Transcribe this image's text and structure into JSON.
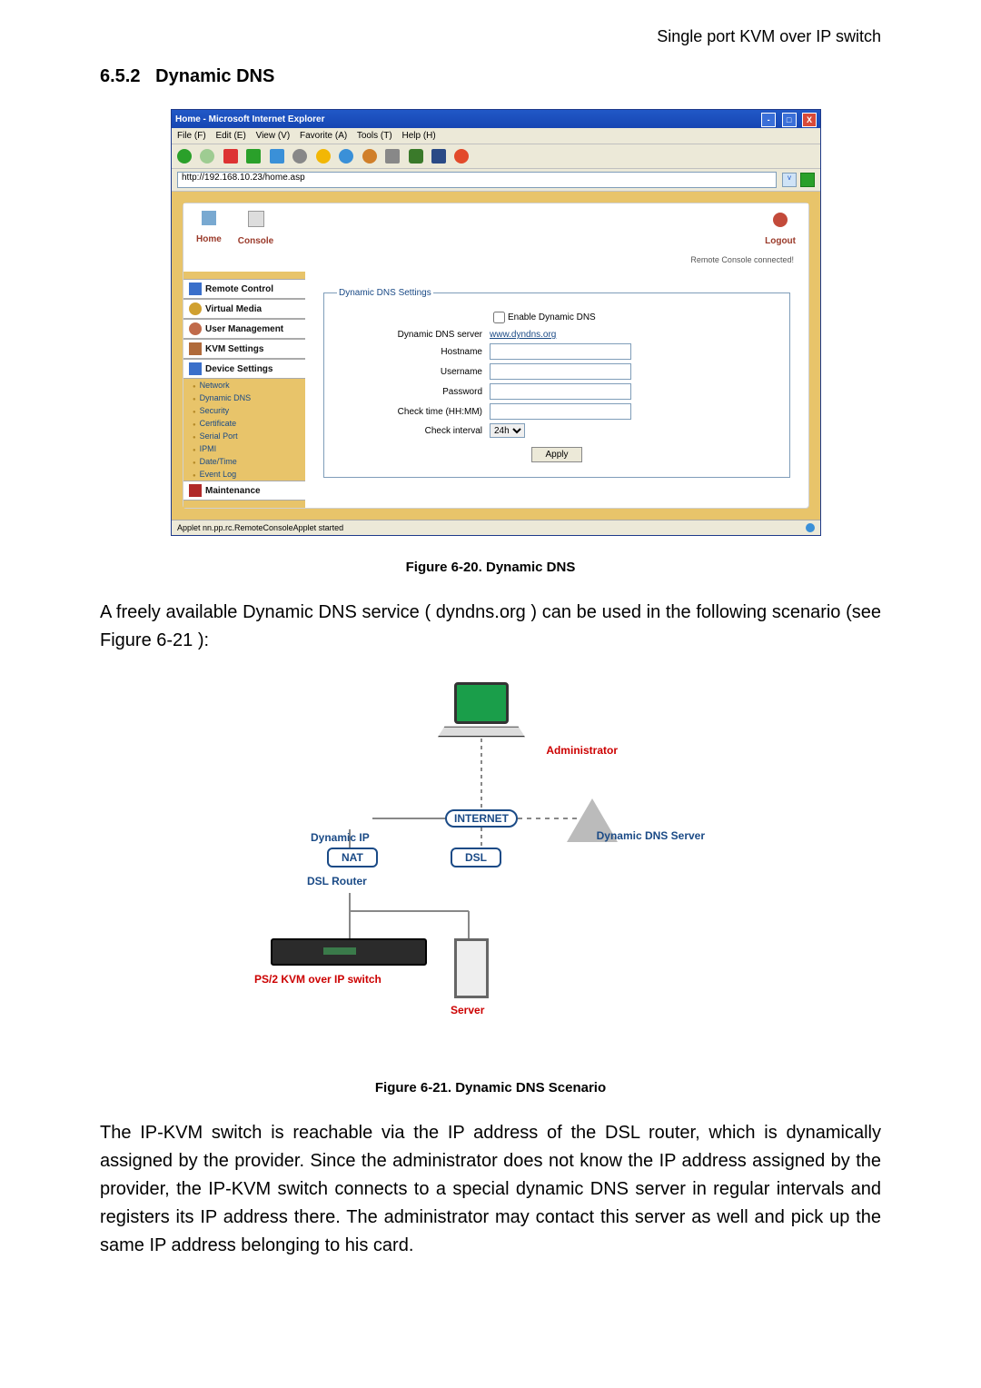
{
  "header": "Single port KVM over IP switch",
  "section": {
    "number": "6.5.2",
    "title": "Dynamic DNS"
  },
  "iewin": {
    "title": "Home - Microsoft Internet Explorer",
    "menubar": [
      "File (F)",
      "Edit (E)",
      "View (V)",
      "Favorite (A)",
      "Tools (T)",
      "Help (H)"
    ],
    "address": "http://192.168.10.23/home.asp",
    "nav_top": {
      "home": "Home",
      "console": "Console",
      "logout": "Logout"
    },
    "status_right": "Remote Console connected!",
    "nav": {
      "remote_control": "Remote Control",
      "virtual_media": "Virtual Media",
      "user_management": "User Management",
      "kvm_settings": "KVM Settings",
      "device_settings": "Device Settings",
      "subitems": {
        "network": "Network",
        "dynamic_dns": "Dynamic DNS",
        "security": "Security",
        "certificate": "Certificate",
        "serial_port": "Serial Port",
        "ipmi": "IPMI",
        "date_time": "Date/Time",
        "event_log": "Event Log"
      },
      "maintenance": "Maintenance"
    },
    "form": {
      "legend": "Dynamic DNS Settings",
      "enable": "Enable Dynamic DNS",
      "server_label": "Dynamic DNS server",
      "server_value": "www.dyndns.org",
      "hostname": "Hostname",
      "username": "Username",
      "password": "Password",
      "check_time": "Check time (HH:MM)",
      "check_interval": "Check interval",
      "interval_value": "24h",
      "apply": "Apply"
    },
    "statusbar": "Applet nn.pp.rc.RemoteConsoleApplet started"
  },
  "caption1": "Figure 6-20. Dynamic DNS",
  "para1": "A freely available Dynamic DNS service ( dyndns.org ) can be used in the following scenario (see Figure 6-21 ):",
  "diagram": {
    "admin": "Administrator",
    "internet": "INTERNET",
    "dynamic_ip": "Dynamic IP",
    "nat": "NAT",
    "dsl": "DSL",
    "ddns_server": "Dynamic DNS Server",
    "dsl_router": "DSL Router",
    "ps2": "PS/2 KVM over IP switch",
    "server": "Server"
  },
  "caption2": "Figure 6-21. Dynamic DNS Scenario",
  "para2": "The IP-KVM switch is reachable via the IP address of the DSL router, which is dynamically assigned by the provider. Since the administrator does not know the IP address assigned by the provider, the IP-KVM switch connects to a special dynamic DNS server in regular intervals and registers its IP address there. The administrator may contact this server as well and pick up the same IP address belonging to his card."
}
